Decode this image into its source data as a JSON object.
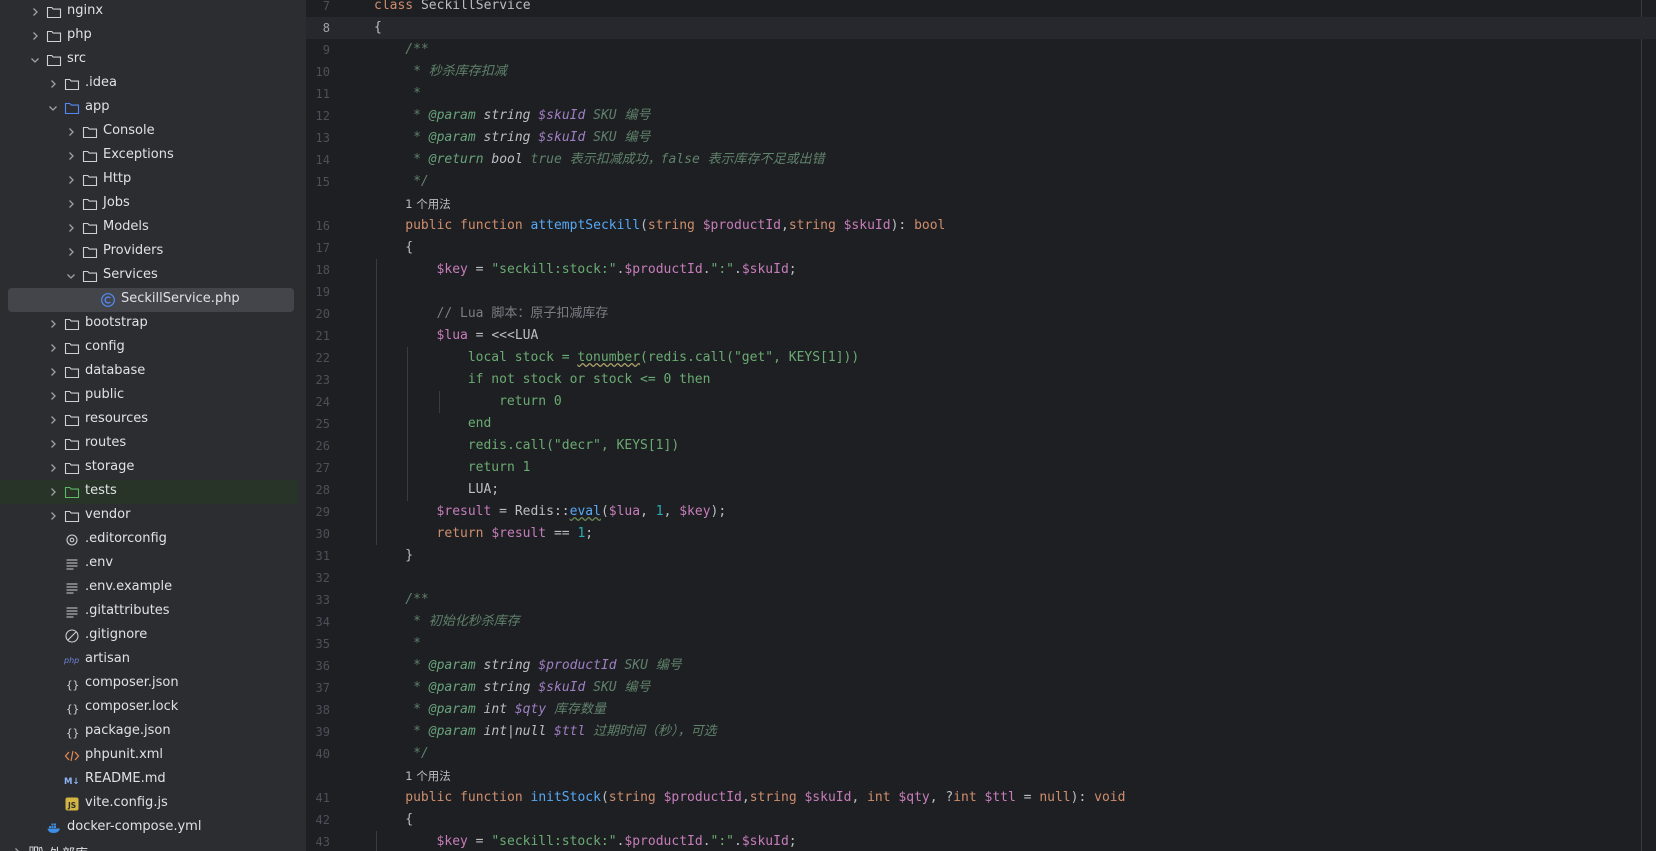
{
  "tree": [
    {
      "label": "nginx",
      "type": "folder",
      "depth": 1,
      "state": "collapsed"
    },
    {
      "label": "php",
      "type": "folder",
      "depth": 1,
      "state": "collapsed"
    },
    {
      "label": "src",
      "type": "folder",
      "depth": 1,
      "state": "expanded"
    },
    {
      "label": ".idea",
      "type": "folder",
      "depth": 2,
      "state": "collapsed"
    },
    {
      "label": "app",
      "type": "folder-blue",
      "depth": 2,
      "state": "expanded"
    },
    {
      "label": "Console",
      "type": "folder",
      "depth": 3,
      "state": "collapsed"
    },
    {
      "label": "Exceptions",
      "type": "folder",
      "depth": 3,
      "state": "collapsed"
    },
    {
      "label": "Http",
      "type": "folder",
      "depth": 3,
      "state": "collapsed"
    },
    {
      "label": "Jobs",
      "type": "folder",
      "depth": 3,
      "state": "collapsed"
    },
    {
      "label": "Models",
      "type": "folder",
      "depth": 3,
      "state": "collapsed"
    },
    {
      "label": "Providers",
      "type": "folder",
      "depth": 3,
      "state": "collapsed"
    },
    {
      "label": "Services",
      "type": "folder",
      "depth": 3,
      "state": "expanded"
    },
    {
      "label": "SeckillService.php",
      "type": "php-class",
      "depth": 4,
      "state": "leaf",
      "selected": true
    },
    {
      "label": "bootstrap",
      "type": "folder",
      "depth": 2,
      "state": "collapsed"
    },
    {
      "label": "config",
      "type": "folder",
      "depth": 2,
      "state": "collapsed"
    },
    {
      "label": "database",
      "type": "folder",
      "depth": 2,
      "state": "collapsed"
    },
    {
      "label": "public",
      "type": "folder",
      "depth": 2,
      "state": "collapsed"
    },
    {
      "label": "resources",
      "type": "folder",
      "depth": 2,
      "state": "collapsed"
    },
    {
      "label": "routes",
      "type": "folder",
      "depth": 2,
      "state": "collapsed"
    },
    {
      "label": "storage",
      "type": "folder",
      "depth": 2,
      "state": "collapsed"
    },
    {
      "label": "tests",
      "type": "folder-green",
      "depth": 2,
      "state": "collapsed",
      "vcs_new": true
    },
    {
      "label": "vendor",
      "type": "folder",
      "depth": 2,
      "state": "collapsed"
    },
    {
      "label": ".editorconfig",
      "type": "gear-file",
      "depth": 2,
      "state": "leaf"
    },
    {
      "label": ".env",
      "type": "text-file",
      "depth": 2,
      "state": "leaf"
    },
    {
      "label": ".env.example",
      "type": "text-file",
      "depth": 2,
      "state": "leaf"
    },
    {
      "label": ".gitattributes",
      "type": "text-file",
      "depth": 2,
      "state": "leaf"
    },
    {
      "label": ".gitignore",
      "type": "ignore-file",
      "depth": 2,
      "state": "leaf"
    },
    {
      "label": "artisan",
      "type": "php-file",
      "depth": 2,
      "state": "leaf"
    },
    {
      "label": "composer.json",
      "type": "json-file",
      "depth": 2,
      "state": "leaf"
    },
    {
      "label": "composer.lock",
      "type": "json-file",
      "depth": 2,
      "state": "leaf"
    },
    {
      "label": "package.json",
      "type": "json-file",
      "depth": 2,
      "state": "leaf"
    },
    {
      "label": "phpunit.xml",
      "type": "xml-file",
      "depth": 2,
      "state": "leaf"
    },
    {
      "label": "README.md",
      "type": "md-file",
      "depth": 2,
      "state": "leaf"
    },
    {
      "label": "vite.config.js",
      "type": "js-file",
      "depth": 2,
      "state": "leaf"
    },
    {
      "label": "docker-compose.yml",
      "type": "docker-file",
      "depth": 1,
      "state": "leaf"
    },
    {
      "label": "外部库",
      "type": "library",
      "depth": 0,
      "state": "collapsed"
    }
  ],
  "editor": {
    "current_line": "8",
    "lines": [
      {
        "n": "7",
        "kind": "code",
        "indent": 0,
        "tokens": [
          [
            "kw",
            "class "
          ],
          [
            "cls",
            "SeckillService"
          ]
        ]
      },
      {
        "n": "8",
        "kind": "code",
        "indent": 0,
        "tokens": [
          [
            "p",
            "{"
          ]
        ]
      },
      {
        "n": "9",
        "kind": "code",
        "indent": 1,
        "tokens": [
          [
            "doc",
            "/**"
          ]
        ]
      },
      {
        "n": "10",
        "kind": "code",
        "indent": 1,
        "tokens": [
          [
            "doc",
            " * 秒杀库存扣减"
          ]
        ]
      },
      {
        "n": "11",
        "kind": "code",
        "indent": 1,
        "tokens": [
          [
            "doc",
            " *"
          ]
        ]
      },
      {
        "n": "12",
        "kind": "code",
        "indent": 1,
        "tokens": [
          [
            "doc",
            " * "
          ],
          [
            "doctag",
            "@param"
          ],
          [
            "doctype",
            " string "
          ],
          [
            "docvar",
            "$skuId"
          ],
          [
            "doc",
            " SKU 编号"
          ]
        ]
      },
      {
        "n": "13",
        "kind": "code",
        "indent": 1,
        "tokens": [
          [
            "doc",
            " * "
          ],
          [
            "doctag",
            "@param"
          ],
          [
            "doctype",
            " string "
          ],
          [
            "docvar",
            "$skuId"
          ],
          [
            "doc",
            " SKU 编号"
          ]
        ]
      },
      {
        "n": "14",
        "kind": "code",
        "indent": 1,
        "tokens": [
          [
            "doc",
            " * "
          ],
          [
            "doctag",
            "@return"
          ],
          [
            "doctype",
            " bool "
          ],
          [
            "doc",
            "true 表示扣减成功，false 表示库存不足或出错"
          ]
        ]
      },
      {
        "n": "15",
        "kind": "code",
        "indent": 1,
        "tokens": [
          [
            "doc",
            " */"
          ]
        ]
      },
      {
        "n": "",
        "kind": "hint",
        "indent": 1,
        "tokens": [
          [
            "p",
            "1 个用法"
          ]
        ]
      },
      {
        "n": "16",
        "kind": "code",
        "indent": 1,
        "tokens": [
          [
            "kw",
            "public function "
          ],
          [
            "fn",
            "attemptSeckill"
          ],
          [
            "p",
            "("
          ],
          [
            "kw",
            "string "
          ],
          [
            "var",
            "$productId"
          ],
          [
            "p",
            ","
          ],
          [
            "kw",
            "string "
          ],
          [
            "var",
            "$skuId"
          ],
          [
            "p",
            "): "
          ],
          [
            "kw",
            "bool"
          ]
        ]
      },
      {
        "n": "17",
        "kind": "code",
        "indent": 1,
        "tokens": [
          [
            "p",
            "{"
          ]
        ]
      },
      {
        "n": "18",
        "kind": "code",
        "indent": 2,
        "tokens": [
          [
            "var",
            "$key"
          ],
          [
            "p",
            " = "
          ],
          [
            "str",
            "\"seckill:stock:\""
          ],
          [
            "p",
            "."
          ],
          [
            "var",
            "$productId"
          ],
          [
            "p",
            "."
          ],
          [
            "str",
            "\":\""
          ],
          [
            "p",
            "."
          ],
          [
            "var",
            "$skuId"
          ],
          [
            "p",
            ";"
          ]
        ]
      },
      {
        "n": "19",
        "kind": "code",
        "indent": 2,
        "tokens": []
      },
      {
        "n": "20",
        "kind": "code",
        "indent": 2,
        "tokens": [
          [
            "cmt",
            "// Lua 脚本：原子扣减库存"
          ]
        ]
      },
      {
        "n": "21",
        "kind": "code",
        "indent": 2,
        "tokens": [
          [
            "var",
            "$lua"
          ],
          [
            "p",
            " = <<<LUA"
          ]
        ]
      },
      {
        "n": "22",
        "kind": "code",
        "indent": 3,
        "tokens": [
          [
            "heredoc",
            "local stock = "
          ],
          [
            "wavy",
            "tonumber"
          ],
          [
            "heredoc",
            "(redis.call(\"get\", KEYS[1]))"
          ]
        ]
      },
      {
        "n": "23",
        "kind": "code",
        "indent": 3,
        "tokens": [
          [
            "heredoc",
            "if not stock or stock <= 0 then"
          ]
        ]
      },
      {
        "n": "24",
        "kind": "code",
        "indent": 4,
        "tokens": [
          [
            "heredoc",
            "return 0"
          ]
        ]
      },
      {
        "n": "25",
        "kind": "code",
        "indent": 3,
        "tokens": [
          [
            "heredoc",
            "end"
          ]
        ]
      },
      {
        "n": "26",
        "kind": "code",
        "indent": 3,
        "tokens": [
          [
            "heredoc",
            "redis.call(\"decr\", KEYS[1])"
          ]
        ]
      },
      {
        "n": "27",
        "kind": "code",
        "indent": 3,
        "tokens": [
          [
            "heredoc",
            "return 1"
          ]
        ]
      },
      {
        "n": "28",
        "kind": "code",
        "indent": 3,
        "tokens": [
          [
            "p",
            "LUA;"
          ]
        ]
      },
      {
        "n": "29",
        "kind": "code",
        "indent": 2,
        "tokens": [
          [
            "var",
            "$result"
          ],
          [
            "p",
            " = Redis::"
          ],
          [
            "fncall",
            "eval"
          ],
          [
            "p",
            "("
          ],
          [
            "var",
            "$lua"
          ],
          [
            "p",
            ", "
          ],
          [
            "num",
            "1"
          ],
          [
            "p",
            ", "
          ],
          [
            "var",
            "$key"
          ],
          [
            "p",
            ");"
          ]
        ]
      },
      {
        "n": "30",
        "kind": "code",
        "indent": 2,
        "tokens": [
          [
            "kw",
            "return "
          ],
          [
            "var",
            "$result"
          ],
          [
            "p",
            " == "
          ],
          [
            "num",
            "1"
          ],
          [
            "p",
            ";"
          ]
        ]
      },
      {
        "n": "31",
        "kind": "code",
        "indent": 1,
        "tokens": [
          [
            "p",
            "}"
          ]
        ]
      },
      {
        "n": "32",
        "kind": "code",
        "indent": 1,
        "tokens": []
      },
      {
        "n": "33",
        "kind": "code",
        "indent": 1,
        "tokens": [
          [
            "doc",
            "/**"
          ]
        ]
      },
      {
        "n": "34",
        "kind": "code",
        "indent": 1,
        "tokens": [
          [
            "doc",
            " * 初始化秒杀库存"
          ]
        ]
      },
      {
        "n": "35",
        "kind": "code",
        "indent": 1,
        "tokens": [
          [
            "doc",
            " *"
          ]
        ]
      },
      {
        "n": "36",
        "kind": "code",
        "indent": 1,
        "tokens": [
          [
            "doc",
            " * "
          ],
          [
            "doctag",
            "@param"
          ],
          [
            "doctype",
            " string "
          ],
          [
            "docvar",
            "$productId"
          ],
          [
            "doc",
            " SKU 编号"
          ]
        ]
      },
      {
        "n": "37",
        "kind": "code",
        "indent": 1,
        "tokens": [
          [
            "doc",
            " * "
          ],
          [
            "doctag",
            "@param"
          ],
          [
            "doctype",
            " string "
          ],
          [
            "docvar",
            "$skuId"
          ],
          [
            "doc",
            " SKU 编号"
          ]
        ]
      },
      {
        "n": "38",
        "kind": "code",
        "indent": 1,
        "tokens": [
          [
            "doc",
            " * "
          ],
          [
            "doctag",
            "@param"
          ],
          [
            "doctype",
            " int "
          ],
          [
            "docvar",
            "$qty"
          ],
          [
            "doc",
            " 库存数量"
          ]
        ]
      },
      {
        "n": "39",
        "kind": "code",
        "indent": 1,
        "tokens": [
          [
            "doc",
            " * "
          ],
          [
            "doctag",
            "@param"
          ],
          [
            "doctype",
            " int|null "
          ],
          [
            "docvar",
            "$ttl"
          ],
          [
            "doc",
            " 过期时间（秒），可选"
          ]
        ]
      },
      {
        "n": "40",
        "kind": "code",
        "indent": 1,
        "tokens": [
          [
            "doc",
            " */"
          ]
        ]
      },
      {
        "n": "",
        "kind": "hint",
        "indent": 1,
        "tokens": [
          [
            "p",
            "1 个用法"
          ]
        ]
      },
      {
        "n": "41",
        "kind": "code",
        "indent": 1,
        "tokens": [
          [
            "kw",
            "public function "
          ],
          [
            "fn",
            "initStock"
          ],
          [
            "p",
            "("
          ],
          [
            "kw",
            "string "
          ],
          [
            "var",
            "$productId"
          ],
          [
            "p",
            ","
          ],
          [
            "kw",
            "string "
          ],
          [
            "var",
            "$skuId"
          ],
          [
            "p",
            ", "
          ],
          [
            "kw",
            "int "
          ],
          [
            "var",
            "$qty"
          ],
          [
            "p",
            ", ?"
          ],
          [
            "kw",
            "int "
          ],
          [
            "var",
            "$ttl"
          ],
          [
            "p",
            " = "
          ],
          [
            "kw",
            "null"
          ],
          [
            "p",
            "): "
          ],
          [
            "kw",
            "void"
          ]
        ]
      },
      {
        "n": "42",
        "kind": "code",
        "indent": 1,
        "tokens": [
          [
            "p",
            "{"
          ]
        ]
      },
      {
        "n": "43",
        "kind": "code",
        "indent": 2,
        "tokens": [
          [
            "var",
            "$key"
          ],
          [
            "p",
            " = "
          ],
          [
            "str",
            "\"seckill:stock:\""
          ],
          [
            "p",
            "."
          ],
          [
            "var",
            "$productId"
          ],
          [
            "p",
            "."
          ],
          [
            "str",
            "\":\""
          ],
          [
            "p",
            "."
          ],
          [
            "var",
            "$skuId"
          ],
          [
            "p",
            ";"
          ]
        ]
      }
    ]
  }
}
